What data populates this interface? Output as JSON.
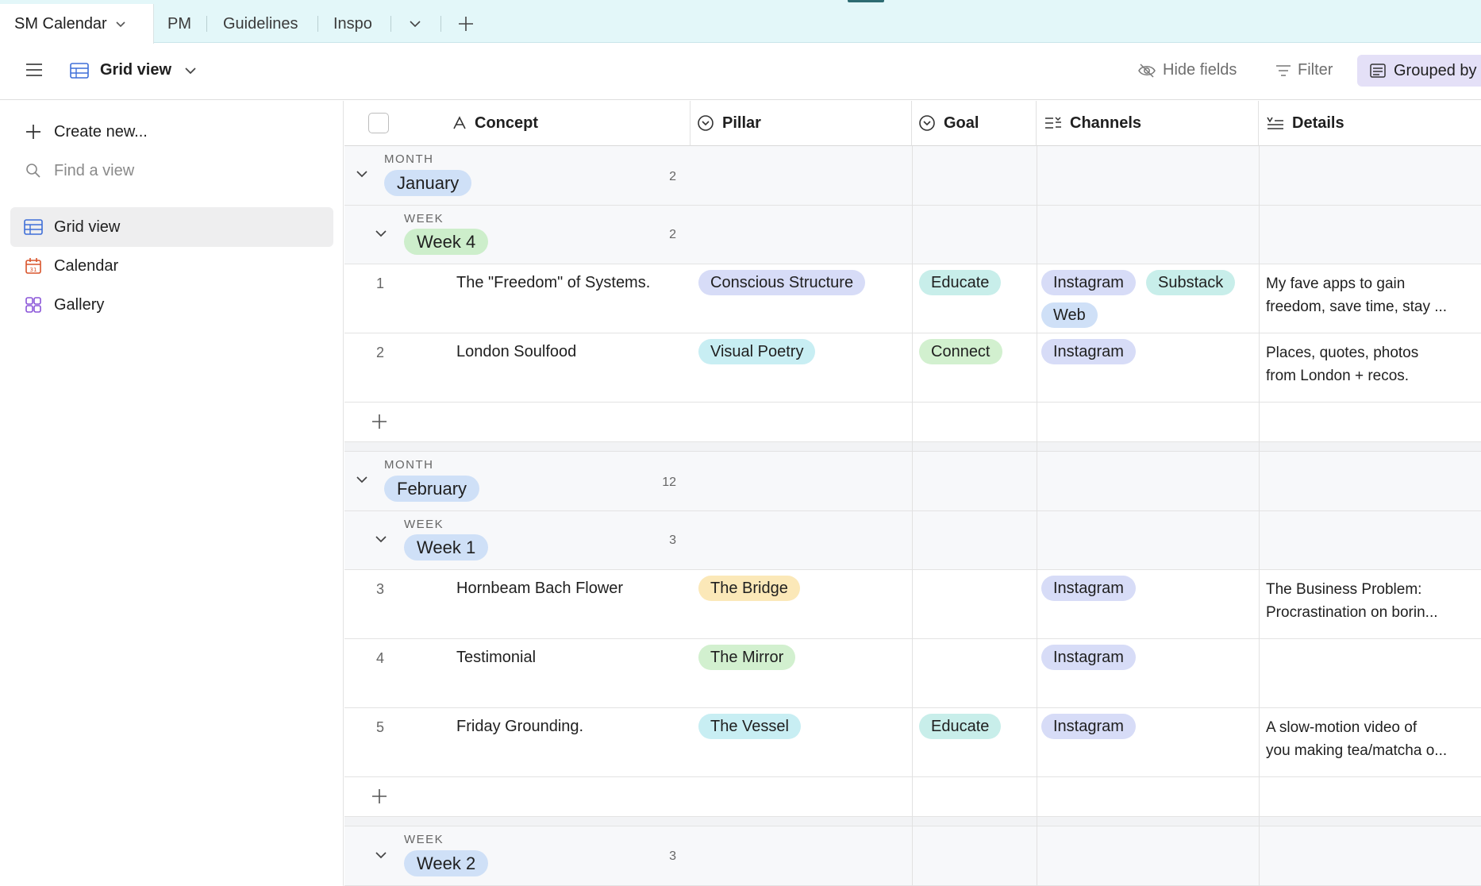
{
  "tabs": {
    "active": "SM Calendar",
    "others": [
      "PM",
      "Guidelines",
      "Inspo"
    ]
  },
  "toolbar": {
    "view_name": "Grid view",
    "hide_fields": "Hide fields",
    "filter": "Filter",
    "grouped_by": "Grouped by"
  },
  "sidebar": {
    "create_new": "Create new...",
    "find_placeholder": "Find a view",
    "views": [
      {
        "label": "Grid view",
        "icon": "grid-icon",
        "selected": true
      },
      {
        "label": "Calendar",
        "icon": "calendar-icon",
        "selected": false
      },
      {
        "label": "Gallery",
        "icon": "gallery-icon",
        "selected": false
      }
    ]
  },
  "columns": {
    "concept": "Concept",
    "pillar": "Pillar",
    "goal": "Goal",
    "channels": "Channels",
    "details": "Details"
  },
  "groups": {
    "month_label": "MONTH",
    "week_label": "WEEK",
    "january": {
      "name": "January",
      "count": "2"
    },
    "jan_week4": {
      "name": "Week 4",
      "count": "2"
    },
    "february": {
      "name": "February",
      "count": "12"
    },
    "feb_week1": {
      "name": "Week 1",
      "count": "3"
    },
    "feb_week2": {
      "name": "Week 2",
      "count": "3"
    }
  },
  "rows": [
    {
      "num": "1",
      "concept": "The \"Freedom\" of Systems.",
      "pillar": "Conscious Structure",
      "goal": "Educate",
      "channels": [
        "Instagram",
        "Substack",
        "Web"
      ],
      "details1": "My fave apps to gain",
      "details2": "freedom, save time, stay ..."
    },
    {
      "num": "2",
      "concept": "London Soulfood",
      "pillar": "Visual Poetry",
      "goal": "Connect",
      "channels": [
        "Instagram"
      ],
      "details1": "Places, quotes, photos",
      "details2": "from London + recos."
    },
    {
      "num": "3",
      "concept": "Hornbeam Bach Flower",
      "pillar": "The Bridge",
      "goal": "",
      "channels": [
        "Instagram"
      ],
      "details1": "The Business Problem:",
      "details2": "Procrastination on borin..."
    },
    {
      "num": "4",
      "concept": "Testimonial",
      "pillar": "The Mirror",
      "goal": "",
      "channels": [
        "Instagram"
      ],
      "details1": "",
      "details2": ""
    },
    {
      "num": "5",
      "concept": "Friday Grounding.",
      "pillar": "The Vessel",
      "goal": "Educate",
      "channels": [
        "Instagram"
      ],
      "details1": "A slow-motion video of",
      "details2": "you making tea/matcha o..."
    }
  ],
  "colors": {
    "tabbar_bg": "#e3f7f9",
    "month_chip": "#cfe0f7",
    "week_chip_green": "#cdeecb",
    "week_chip_blue": "#cfe0f7",
    "pillar_purple": "#d7dcf7",
    "pillar_cyan": "#c8eef3",
    "pillar_yellow": "#fbe8b8",
    "pillar_green": "#d2f0cf",
    "goal_teal": "#c8eeea",
    "goal_green": "#d2f0cf",
    "channel_instagram": "#d7dcf7",
    "channel_substack": "#c8eeea",
    "channel_web": "#cfe0f7",
    "grouped_by_bg": "#e4e0f7"
  }
}
